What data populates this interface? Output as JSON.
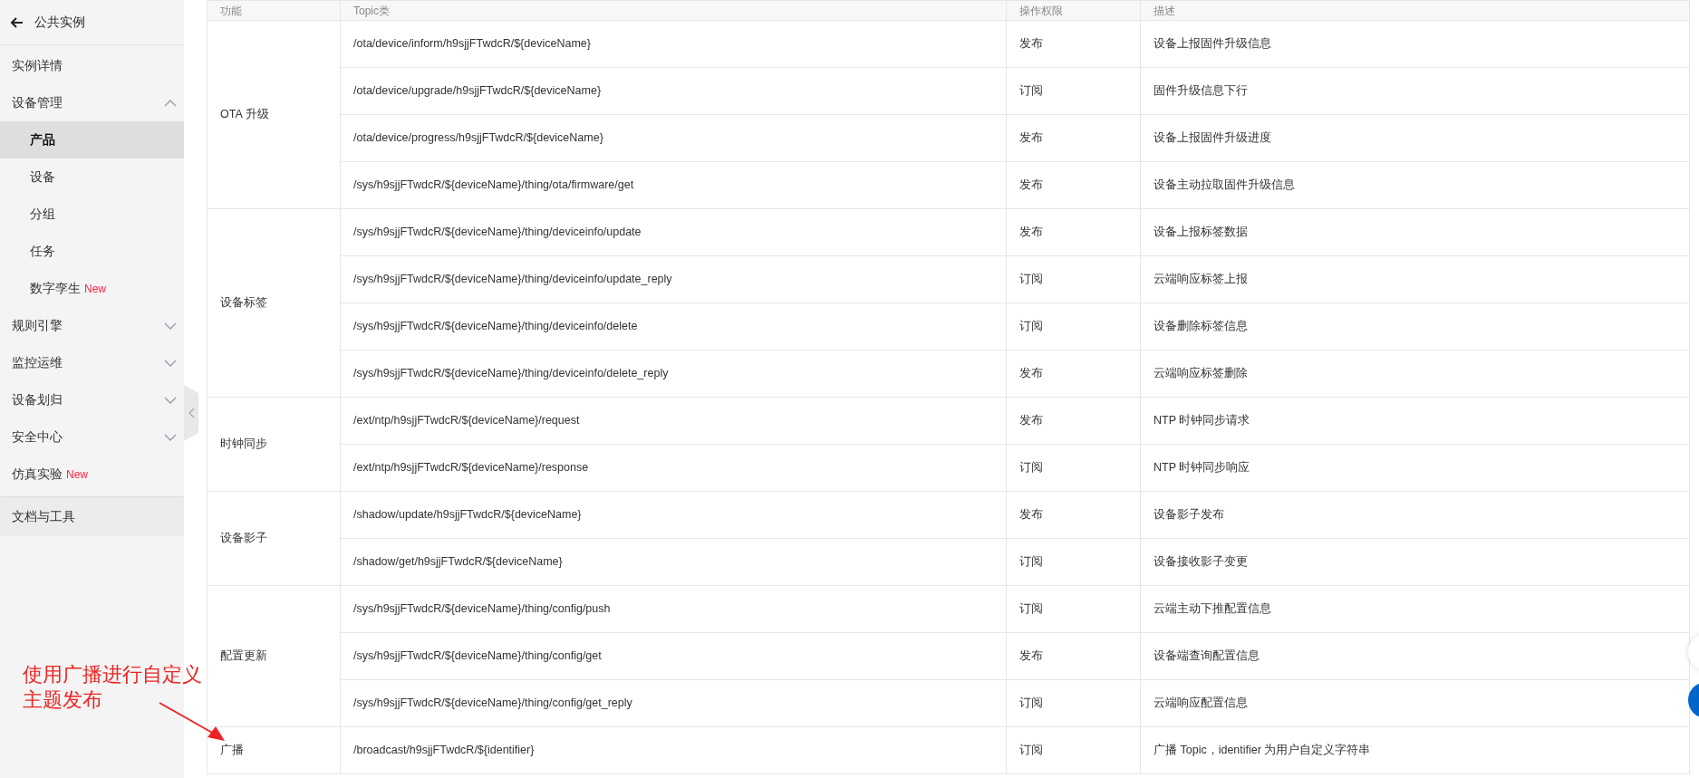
{
  "sidebar": {
    "back_label": "公共实例",
    "items": [
      {
        "label": "实例详情",
        "selected": false
      },
      {
        "label": "设备管理",
        "selected": false,
        "expanded": true,
        "children": [
          {
            "label": "产品",
            "selected": true
          },
          {
            "label": "设备",
            "selected": false
          },
          {
            "label": "分组",
            "selected": false
          },
          {
            "label": "任务",
            "selected": false
          },
          {
            "label": "数字孪生",
            "selected": false,
            "badge": "New"
          }
        ]
      },
      {
        "label": "规则引擎",
        "selected": false,
        "expanded": false
      },
      {
        "label": "监控运维",
        "selected": false,
        "expanded": false
      },
      {
        "label": "设备划归",
        "selected": false,
        "expanded": false
      },
      {
        "label": "安全中心",
        "selected": false,
        "expanded": false
      },
      {
        "label": "仿真实验",
        "selected": false,
        "badge": "New"
      }
    ],
    "footer_item": "文档与工具"
  },
  "table": {
    "columns": [
      "功能",
      "Topic类",
      "操作权限",
      "描述"
    ],
    "groups": [
      {
        "function": "OTA 升级",
        "rows": [
          [
            "/ota/device/inform/h9sjjFTwdcR/${deviceName}",
            "发布",
            "设备上报固件升级信息"
          ],
          [
            "/ota/device/upgrade/h9sjjFTwdcR/${deviceName}",
            "订阅",
            "固件升级信息下行"
          ],
          [
            "/ota/device/progress/h9sjjFTwdcR/${deviceName}",
            "发布",
            "设备上报固件升级进度"
          ],
          [
            "/sys/h9sjjFTwdcR/${deviceName}/thing/ota/firmware/get",
            "发布",
            "设备主动拉取固件升级信息"
          ]
        ]
      },
      {
        "function": "设备标签",
        "rows": [
          [
            "/sys/h9sjjFTwdcR/${deviceName}/thing/deviceinfo/update",
            "发布",
            "设备上报标签数据"
          ],
          [
            "/sys/h9sjjFTwdcR/${deviceName}/thing/deviceinfo/update_reply",
            "订阅",
            "云端响应标签上报"
          ],
          [
            "/sys/h9sjjFTwdcR/${deviceName}/thing/deviceinfo/delete",
            "订阅",
            "设备删除标签信息"
          ],
          [
            "/sys/h9sjjFTwdcR/${deviceName}/thing/deviceinfo/delete_reply",
            "发布",
            "云端响应标签删除"
          ]
        ]
      },
      {
        "function": "时钟同步",
        "rows": [
          [
            "/ext/ntp/h9sjjFTwdcR/${deviceName}/request",
            "发布",
            "NTP 时钟同步请求"
          ],
          [
            "/ext/ntp/h9sjjFTwdcR/${deviceName}/response",
            "订阅",
            "NTP 时钟同步响应"
          ]
        ]
      },
      {
        "function": "设备影子",
        "rows": [
          [
            "/shadow/update/h9sjjFTwdcR/${deviceName}",
            "发布",
            "设备影子发布"
          ],
          [
            "/shadow/get/h9sjjFTwdcR/${deviceName}",
            "订阅",
            "设备接收影子变更"
          ]
        ]
      },
      {
        "function": "配置更新",
        "rows": [
          [
            "/sys/h9sjjFTwdcR/${deviceName}/thing/config/push",
            "订阅",
            "云端主动下推配置信息"
          ],
          [
            "/sys/h9sjjFTwdcR/${deviceName}/thing/config/get",
            "发布",
            "设备端查询配置信息"
          ],
          [
            "/sys/h9sjjFTwdcR/${deviceName}/thing/config/get_reply",
            "订阅",
            "云端响应配置信息"
          ]
        ]
      },
      {
        "function": "广播",
        "rows": [
          [
            "/broadcast/h9sjjFTwdcR/${identifier}",
            "订阅",
            "广播 Topic，identifier 为用户自定义字符串"
          ]
        ]
      }
    ]
  },
  "annotation": [
    "使用广播进行自定义",
    "主题发布"
  ]
}
